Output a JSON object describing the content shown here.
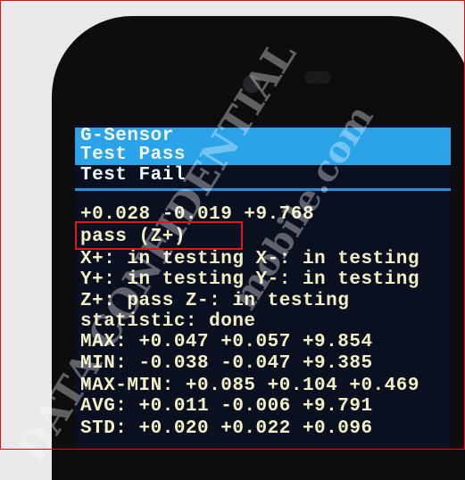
{
  "watermark": "DATA CONFIDENTIAL  mobile.com",
  "menu": {
    "title": "G-Sensor",
    "items": [
      "Test Pass",
      "Test Fail"
    ]
  },
  "current_reading": "+0.028 -0.019 +9.768",
  "result": "pass (Z+)",
  "axes": [
    "X+: in testing X-: in testing",
    "Y+: in testing Y-: in testing",
    "Z+: pass Z-: in testing"
  ],
  "statistic": "statistic: done",
  "stats": [
    "MAX: +0.047 +0.057 +9.854",
    "MIN: -0.038 -0.047 +9.385",
    "MAX-MIN: +0.085 +0.104 +0.469",
    "AVG: +0.011 -0.006 +9.791",
    "STD: +0.020 +0.022 +0.096"
  ],
  "colors": {
    "header": "#2aa3e8",
    "text": "#f3f0c6",
    "highlight": "#e01818"
  }
}
